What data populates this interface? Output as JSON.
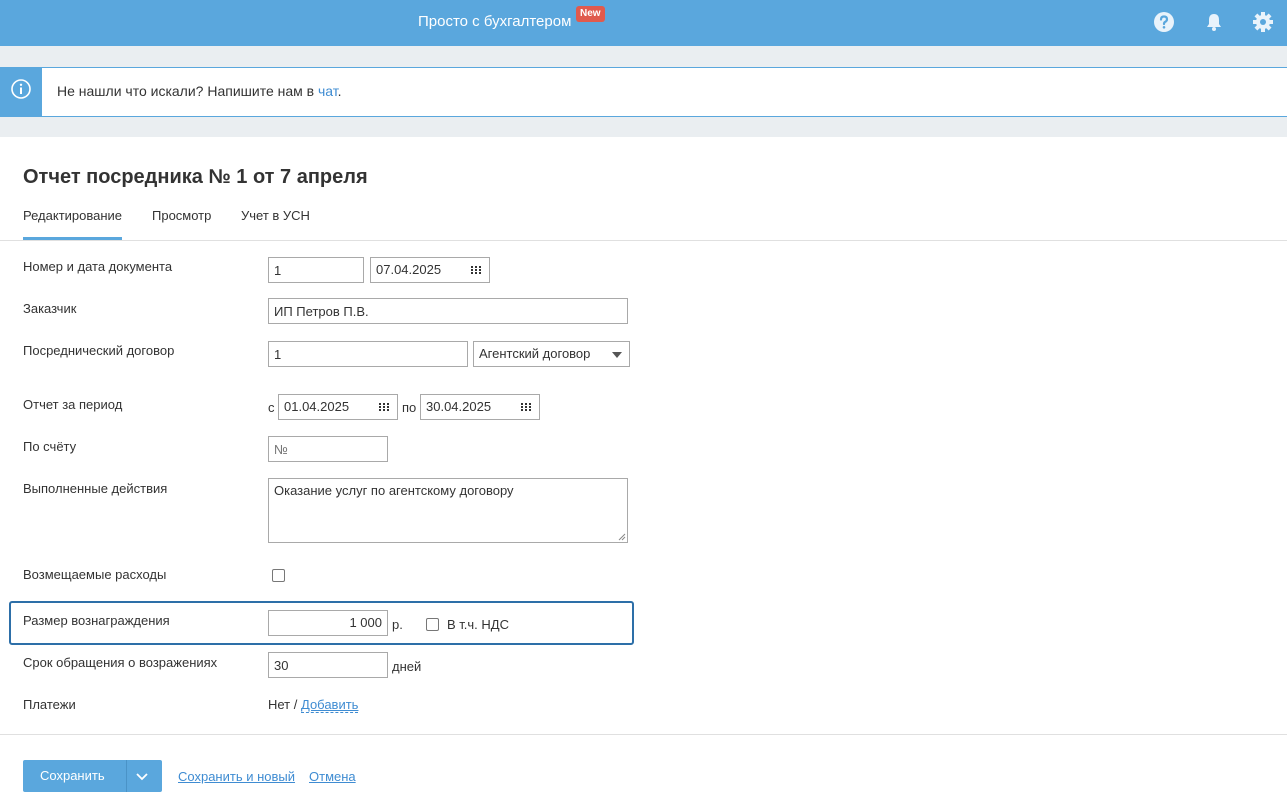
{
  "header": {
    "brand": "Просто с бухгалтером",
    "badge": "New"
  },
  "banner": {
    "text": "Не нашли что искали? Напишите нам в ",
    "link": "чат",
    "suffix": "."
  },
  "page": {
    "title": "Отчет посредника № 1 от 7 апреля",
    "tabs": [
      "Редактирование",
      "Просмотр",
      "Учет в УСН"
    ]
  },
  "form": {
    "doc_label": "Номер и дата документа",
    "doc_number": "1",
    "doc_date": "07.04.2025",
    "customer_label": "Заказчик",
    "customer": "ИП Петров П.В.",
    "contract_label": "Посреднический договор",
    "contract_number": "1",
    "contract_type": "Агентский договор",
    "period_label": "Отчет за период",
    "period_from_prefix": "с",
    "period_from": "01.04.2025",
    "period_to_prefix": "по",
    "period_to": "30.04.2025",
    "invoice_label": "По счёту",
    "invoice_placeholder": "№",
    "actions_label": "Выполненные действия",
    "actions_text": "Оказание услуг по агентскому договору",
    "expenses_label": "Возмещаемые расходы",
    "reward_label": "Размер вознаграждения",
    "reward_value": "1 000",
    "reward_unit": "р.",
    "vat_label": "В т.ч. НДС",
    "objection_label": "Срок обращения о возражениях",
    "objection_value": "30",
    "objection_unit": "дней",
    "payments_label": "Платежи",
    "payments_value": "Нет /",
    "payments_add": "Добавить"
  },
  "footer": {
    "save": "Сохранить",
    "save_new": "Сохранить и новый",
    "cancel": "Отмена"
  },
  "colors": {
    "accent": "#5aa7dd",
    "link": "#3f8cd2",
    "badge": "#e05a4d",
    "highlight": "#2d6fa8"
  }
}
